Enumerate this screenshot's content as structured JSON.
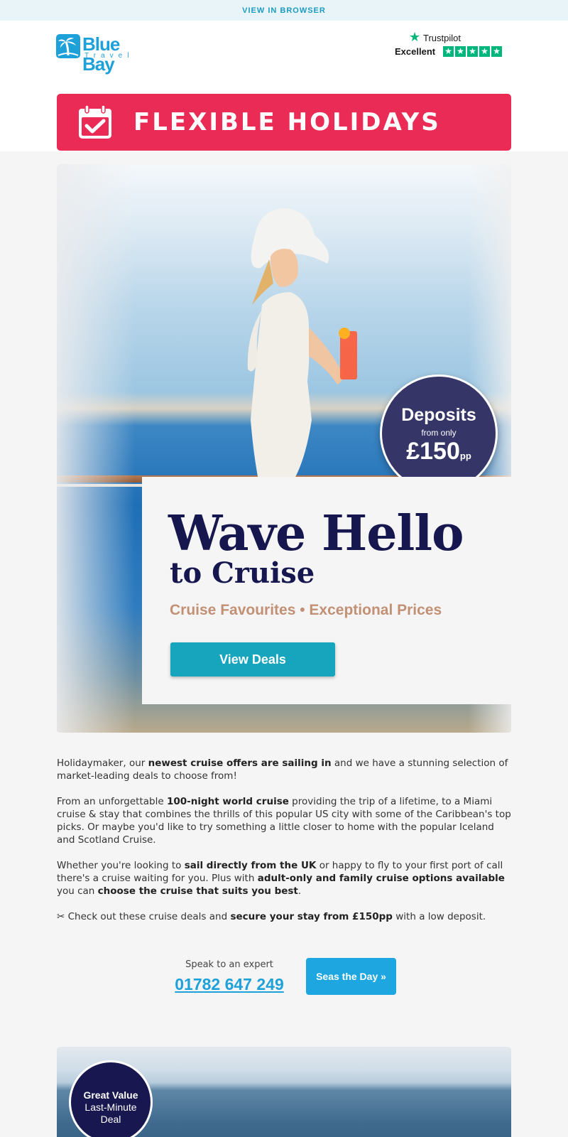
{
  "topbar": {
    "view_in_browser": "VIEW IN BROWSER"
  },
  "brand": {
    "name": "Blue Bay",
    "sub": "Travel"
  },
  "trustpilot": {
    "brand": "Trustpilot",
    "rating": "Excellent",
    "stars": 5,
    "color": "#00b67a"
  },
  "banner": {
    "text": "FLEXIBLE HOLIDAYS",
    "color": "#ea2b55"
  },
  "hero": {
    "deposit_title": "Deposits",
    "deposit_from": "from only",
    "deposit_price": "£150",
    "deposit_unit": "pp",
    "headline": "Wave Hello",
    "subheadline": "to Cruise",
    "tagline": "Cruise Favourites •  Exceptional Prices",
    "cta": "View Deals",
    "cta_color": "#16a5bd",
    "headline_color": "#16174f"
  },
  "copy": {
    "p1": [
      "Holidaymaker, our ",
      "newest cruise offers are sailing in",
      " and we have a stunning selection of market-leading deals to choose from!"
    ],
    "p2": [
      "From an unforgettable ",
      "100-night world cruise",
      " providing the trip of a lifetime, to a Miami cruise & stay that combines the thrills of this popular US city with some of the Caribbean's top picks. Or maybe you'd like to try something a little closer to home with the popular Iceland and Scotland Cruise."
    ],
    "p3": [
      "Whether you're looking to ",
      "sail directly from the UK",
      " or happy to fly to your first port of call there's a cruise waiting for you. Plus with ",
      "adult-only and family cruise options available",
      " you can ",
      "choose the cruise that suits you best",
      "."
    ],
    "p4": [
      "✂ Check out these cruise deals and ",
      "secure your stay from £150pp",
      " with a low deposit."
    ]
  },
  "contact": {
    "label": "Speak to an expert",
    "phone": "01782 647 249",
    "cta": "Seas the Day »"
  },
  "promo2": {
    "line1": "Great Value",
    "line2": "Last-Minute",
    "line3": "Deal"
  }
}
